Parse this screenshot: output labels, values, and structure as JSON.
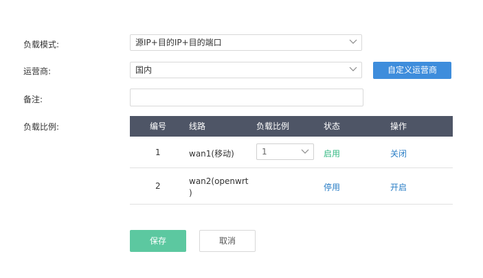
{
  "form": {
    "load_mode": {
      "label": "负载模式:",
      "value": "源IP+目的IP+目的端口"
    },
    "carrier": {
      "label": "运营商:",
      "value": "国内",
      "custom_button": "自定义运营商"
    },
    "note": {
      "label": "备注:",
      "value": ""
    },
    "ratio": {
      "label": "负载比例:"
    }
  },
  "table": {
    "headers": [
      "编号",
      "线路",
      "负载比例",
      "状态",
      "操作"
    ],
    "rows": [
      {
        "id": "1",
        "line": "wan1(移动)",
        "ratio": "1",
        "status": "启用",
        "action": "关闭"
      },
      {
        "id": "2",
        "line": "wan2(openwrt)",
        "line_part1": "wan2(openwrt",
        "line_part2": ")",
        "ratio": "",
        "status": "停用",
        "action": "开启"
      }
    ]
  },
  "buttons": {
    "save": "保存",
    "cancel": "取消"
  },
  "colors": {
    "header_bg": "#4e5566",
    "primary_blue": "#3e8ddc",
    "save_green": "#5cc8a0",
    "status_green": "#35b983",
    "link_blue": "#2a7ec6"
  }
}
